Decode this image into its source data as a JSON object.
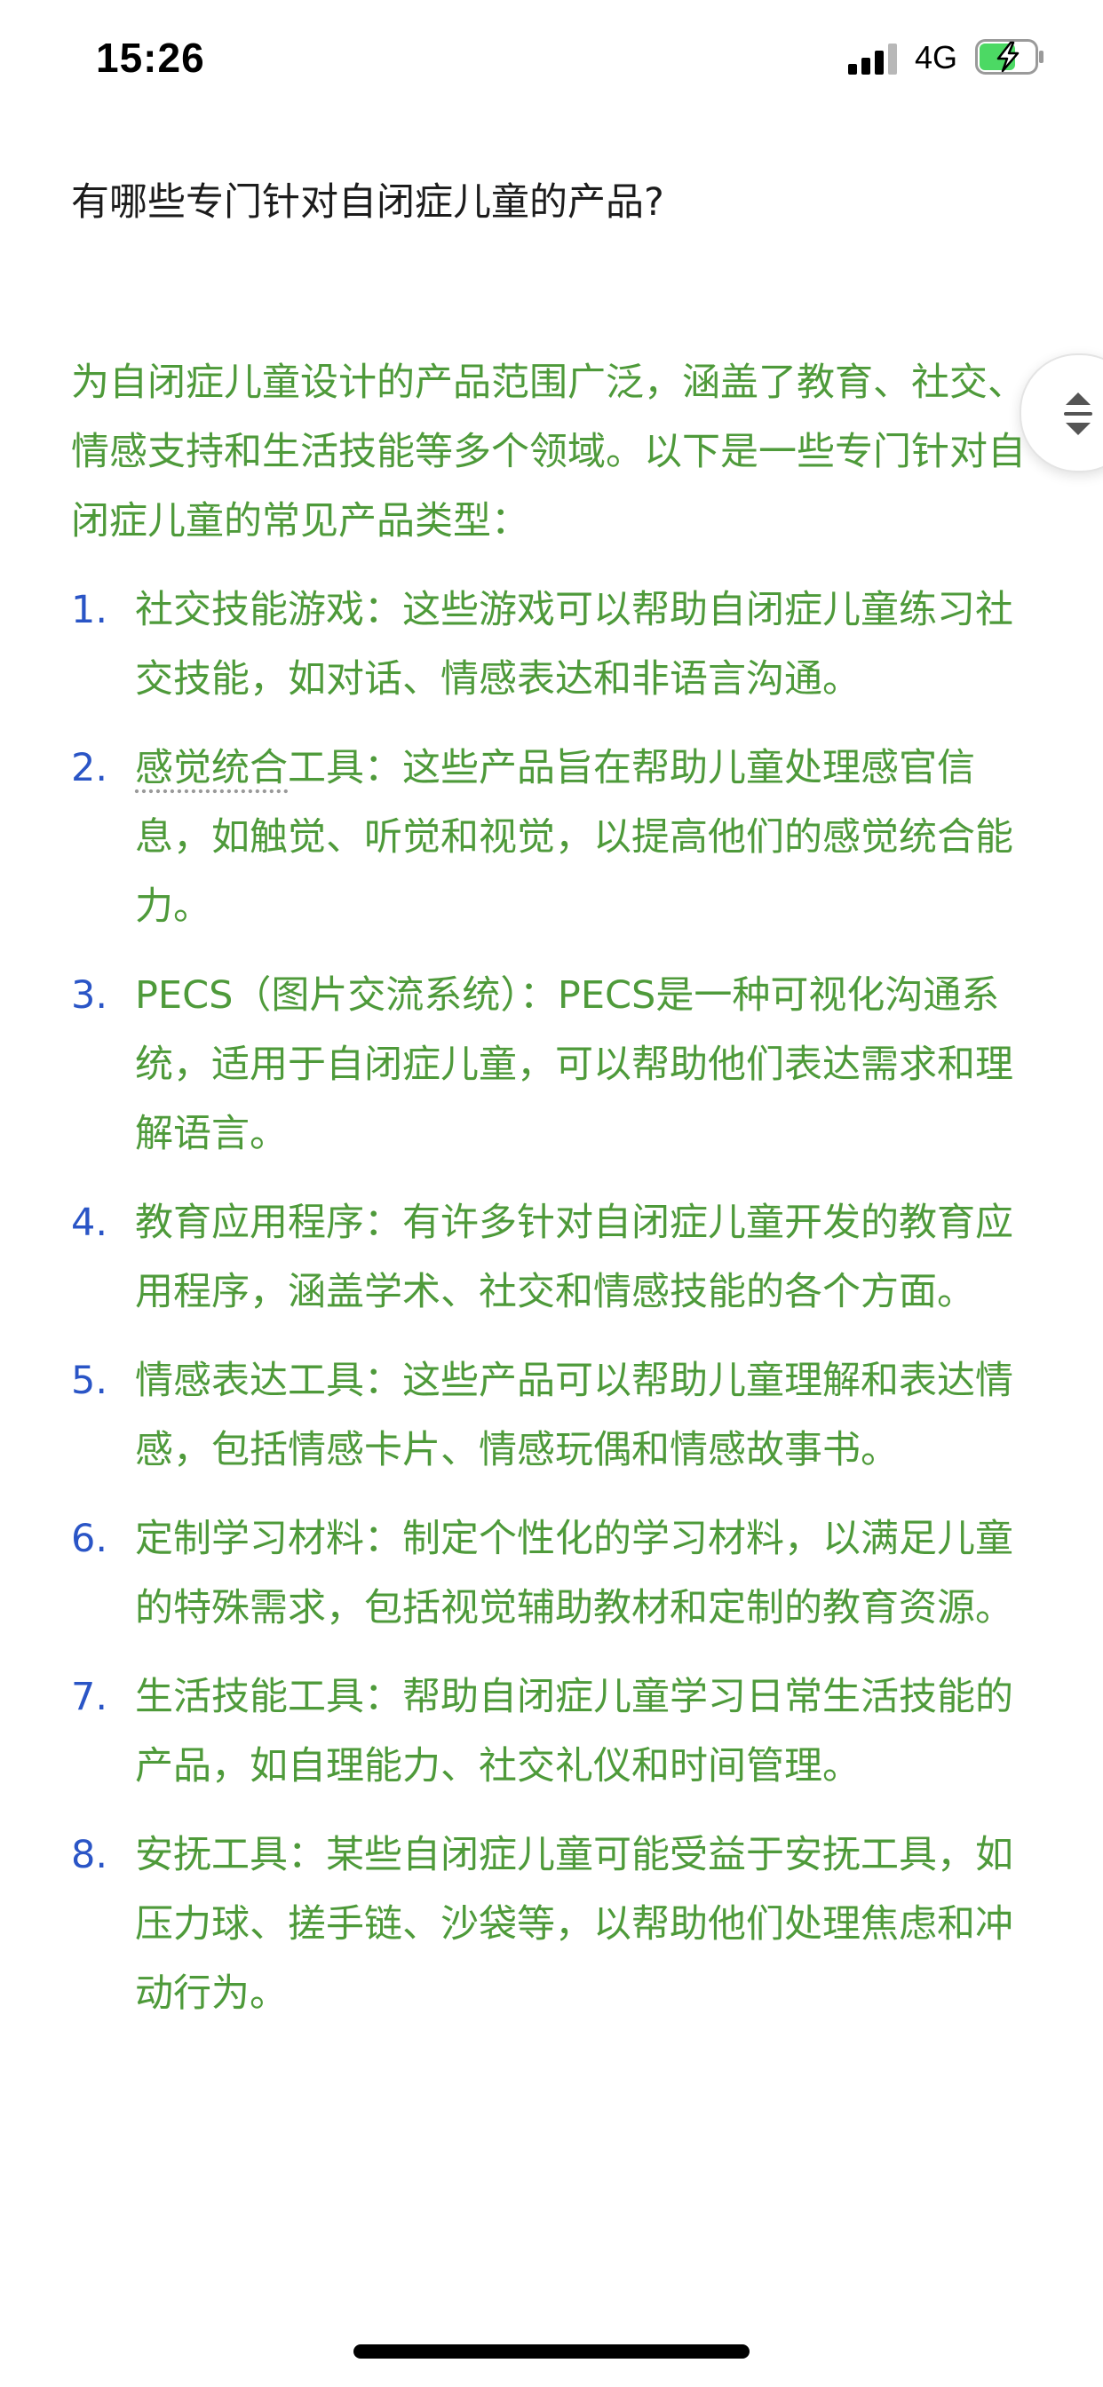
{
  "status_bar": {
    "time": "15:26",
    "network": "4G",
    "battery_state": "charging",
    "battery_color": "#4cd964"
  },
  "chat": {
    "question": "有哪些专门针对自闭症儿童的产品?",
    "answer_intro": "为自闭症儿童设计的产品范围广泛，涵盖了教育、社交、情感支持和生活技能等多个领域。以下是一些专门针对自闭症儿童的常见产品类型：",
    "items": [
      {
        "num": "1.",
        "text": "社交技能游戏：这些游戏可以帮助自闭症儿童练习社交技能，如对话、情感表达和非语言沟通。"
      },
      {
        "num": "2.",
        "pre": "",
        "underlined": "感觉统合",
        "text": "工具：这些产品旨在帮助儿童处理感官信息，如触觉、听觉和视觉，以提高他们的感觉统合能力。"
      },
      {
        "num": "3.",
        "text": "PECS（图片交流系统）：PECS是一种可视化沟通系统，适用于自闭症儿童，可以帮助他们表达需求和理解语言。"
      },
      {
        "num": "4.",
        "text": "教育应用程序：有许多针对自闭症儿童开发的教育应用程序，涵盖学术、社交和情感技能的各个方面。"
      },
      {
        "num": "5.",
        "text": "情感表达工具：这些产品可以帮助儿童理解和表达情感，包括情感卡片、情感玩偶和情感故事书。"
      },
      {
        "num": "6.",
        "text": "定制学习材料：制定个性化的学习材料，以满足儿童的特殊需求，包括视觉辅助教材和定制的教育资源。"
      },
      {
        "num": "7.",
        "text": "生活技能工具：帮助自闭症儿童学习日常生活技能的产品，如自理能力、社交礼仪和时间管理。"
      },
      {
        "num": "8.",
        "text": "安抚工具：某些自闭症儿童可能受益于安抚工具，如压力球、搓手链、沙袋等，以帮助他们处理焦虑和冲动行为。"
      }
    ]
  },
  "icons": {
    "scroll_button": "collapse-expand-icon"
  },
  "colors": {
    "answer_text": "#4e9a3a",
    "list_number": "#2a55c6",
    "question_text": "#1c1c1c"
  }
}
